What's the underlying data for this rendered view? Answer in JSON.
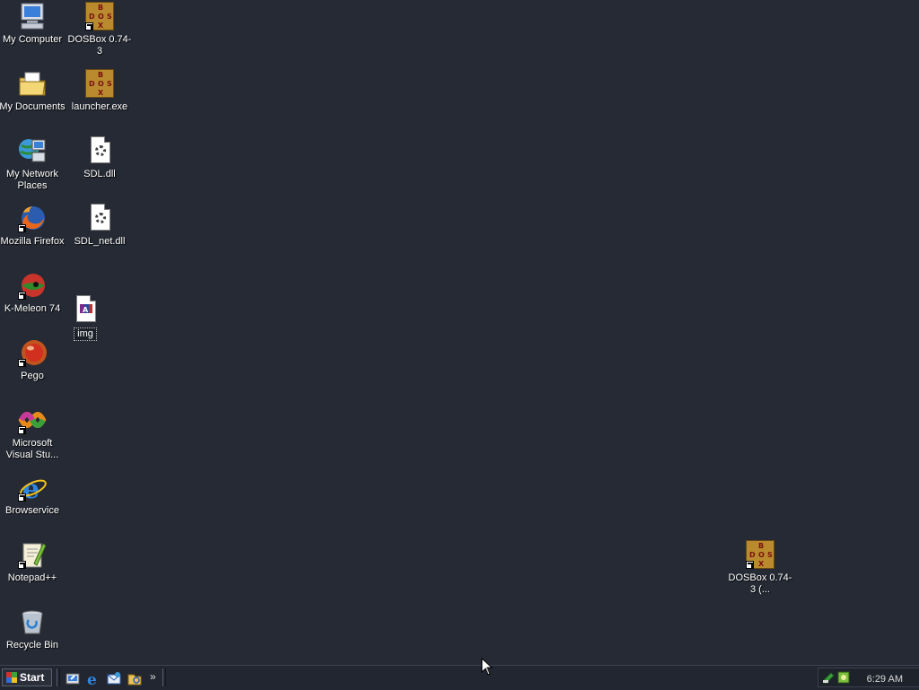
{
  "desktop": {
    "icons": {
      "my_computer": "My Computer",
      "dosbox": "DOSBox 0.74-3",
      "my_documents": "My Documents",
      "launcher": "launcher.exe",
      "network_places": "My Network Places",
      "sdl_dll": "SDL.dll",
      "firefox": "Mozilla Firefox",
      "sdl_net_dll": "SDL_net.dll",
      "kmeleon": "K-Meleon 74",
      "img_file": "img",
      "pego": "Pego",
      "visual_studio": "Microsoft Visual Stu...",
      "browservice": "Browservice",
      "notepadpp": "Notepad++",
      "recycle_bin": "Recycle Bin",
      "dosbox_copy": "DOSBox 0.74-3 (..."
    }
  },
  "taskbar": {
    "start_label": "Start",
    "overflow": "»",
    "clock": "6:29 AM"
  }
}
